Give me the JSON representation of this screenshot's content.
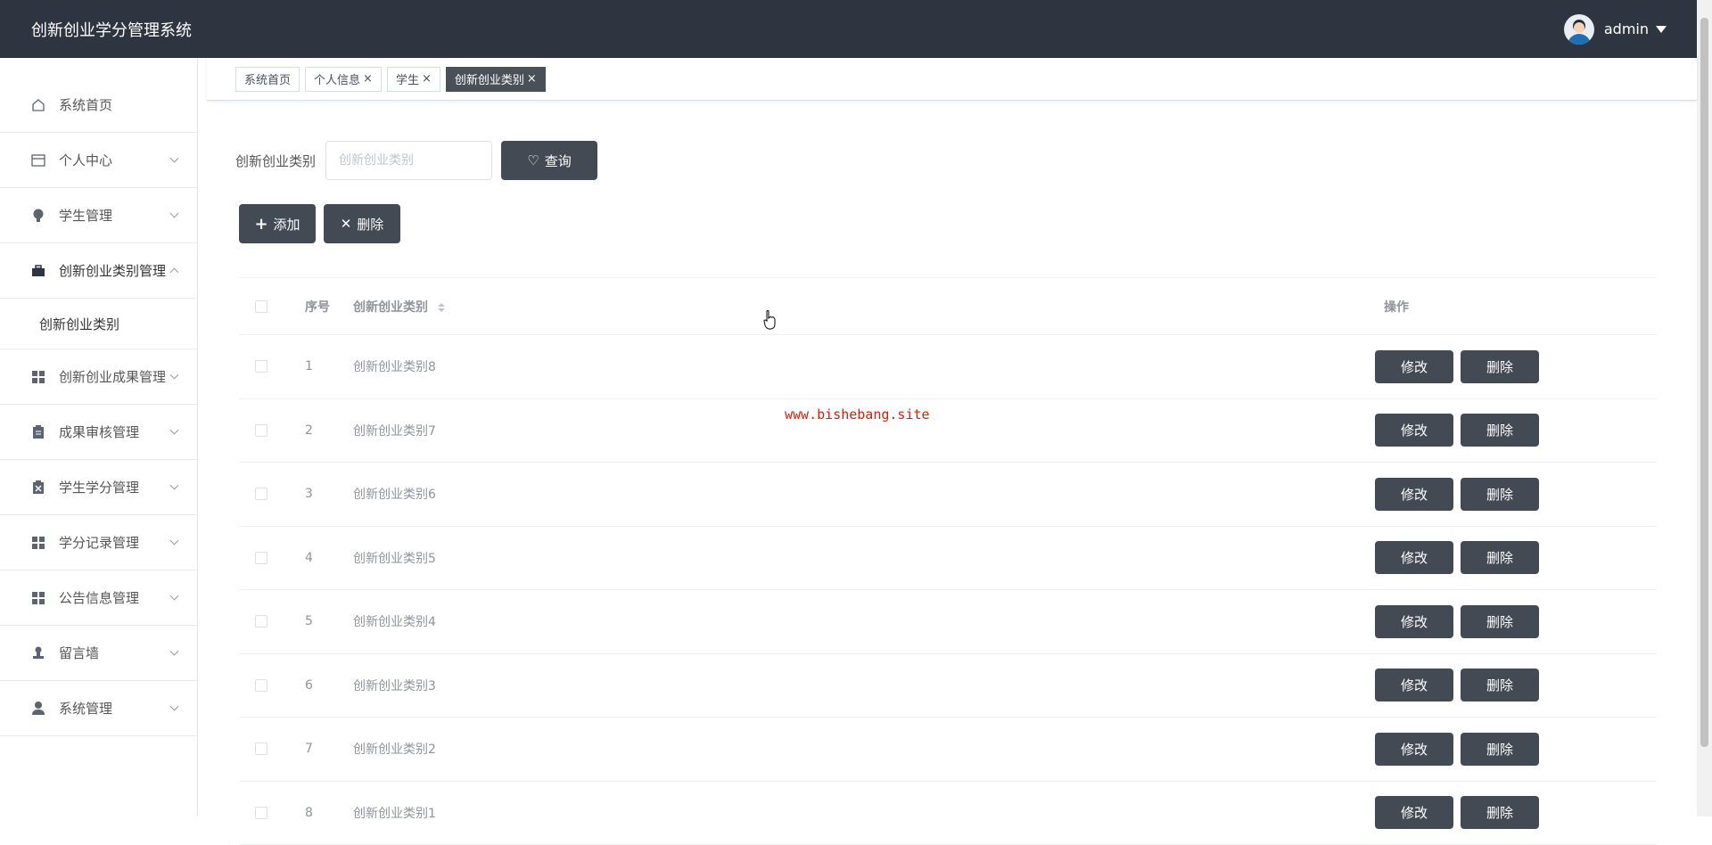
{
  "header": {
    "title": "创新创业学分管理系统",
    "username": "admin"
  },
  "sidebar": {
    "items": [
      {
        "label": "系统首页",
        "icon": "home-icon"
      },
      {
        "label": "个人中心",
        "icon": "card-icon"
      },
      {
        "label": "学生管理",
        "icon": "bulb-icon"
      },
      {
        "label": "创新创业类别管理",
        "icon": "briefcase-icon"
      },
      {
        "label": "创新创业成果管理",
        "icon": "grid-icon"
      },
      {
        "label": "成果审核管理",
        "icon": "clipboard-icon"
      },
      {
        "label": "学生学分管理",
        "icon": "clipboard-x-icon"
      },
      {
        "label": "学分记录管理",
        "icon": "grid-icon"
      },
      {
        "label": "公告信息管理",
        "icon": "grid-icon"
      },
      {
        "label": "留言墙",
        "icon": "stamp-icon"
      },
      {
        "label": "系统管理",
        "icon": "user-icon"
      }
    ],
    "sub_item": "创新创业类别"
  },
  "tabs": [
    {
      "label": "系统首页",
      "closable": false
    },
    {
      "label": "个人信息",
      "closable": true
    },
    {
      "label": "学生",
      "closable": true
    },
    {
      "label": "创新创业类别",
      "closable": true,
      "active": true
    }
  ],
  "search": {
    "label": "创新创业类别",
    "placeholder": "创新创业类别",
    "button": "查询"
  },
  "actions": {
    "add": "添加",
    "delete": "删除"
  },
  "table": {
    "headers": {
      "index": "序号",
      "name": "创新创业类别",
      "op": "操作"
    },
    "rows": [
      {
        "index": "1",
        "name": "创新创业类别8"
      },
      {
        "index": "2",
        "name": "创新创业类别7"
      },
      {
        "index": "3",
        "name": "创新创业类别6"
      },
      {
        "index": "4",
        "name": "创新创业类别5"
      },
      {
        "index": "5",
        "name": "创新创业类别4"
      },
      {
        "index": "6",
        "name": "创新创业类别3"
      },
      {
        "index": "7",
        "name": "创新创业类别2"
      },
      {
        "index": "8",
        "name": "创新创业类别1"
      }
    ],
    "edit_label": "修改",
    "delete_label": "删除"
  },
  "watermark": "www.bishebang.site",
  "colors": {
    "header_bg": "#2f3540",
    "button_dark": "#434a54",
    "watermark": "#d81e06"
  }
}
